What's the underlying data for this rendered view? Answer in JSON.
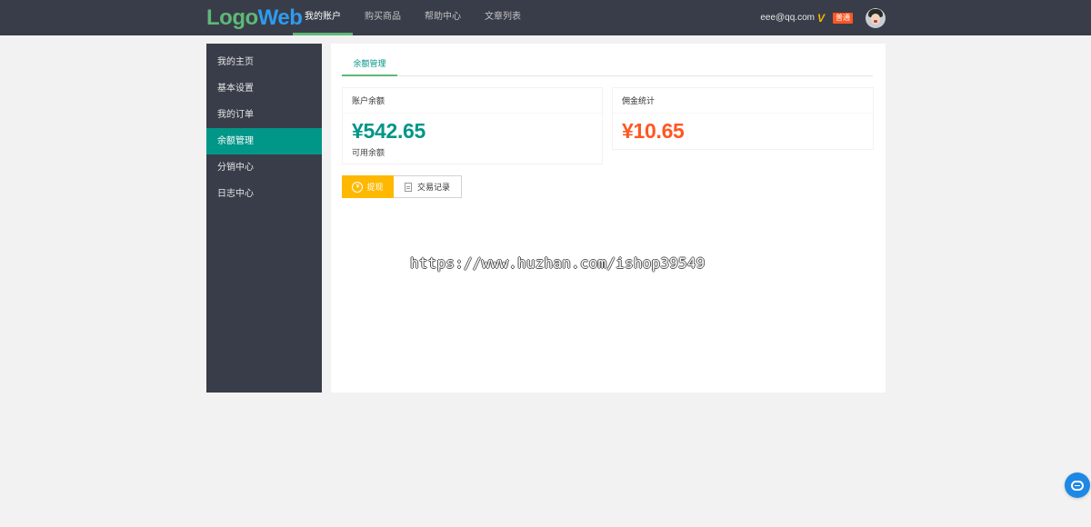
{
  "header": {
    "logo": {
      "part1": "Logo",
      "part2": "Web"
    },
    "nav": [
      {
        "label": "我的账户",
        "active": true
      },
      {
        "label": "购买商品",
        "active": false
      },
      {
        "label": "帮助中心",
        "active": false
      },
      {
        "label": "文章列表",
        "active": false
      }
    ],
    "user": {
      "email": "eee@qq.com",
      "vip_mark": "V",
      "badge": "普通"
    }
  },
  "sidebar": {
    "items": [
      {
        "label": "我的主页",
        "active": false
      },
      {
        "label": "基本设置",
        "active": false
      },
      {
        "label": "我的订单",
        "active": false
      },
      {
        "label": "余额管理",
        "active": true
      },
      {
        "label": "分销中心",
        "active": false
      },
      {
        "label": "日志中心",
        "active": false
      }
    ]
  },
  "main": {
    "tab": "余额管理",
    "balance_card": {
      "title": "账户余额",
      "amount": "¥542.65",
      "note": "可用余额"
    },
    "commission_card": {
      "title": "佣金统计",
      "amount": "¥10.65"
    },
    "buttons": {
      "withdraw_icon": "¥",
      "withdraw": "提现",
      "records": "交易记录"
    }
  },
  "watermark": "https://www.huzhan.com/ishop39549",
  "colors": {
    "topbar": "#393d49",
    "accent": "#009688",
    "orange": "#ff5722",
    "yellow": "#ffb800",
    "float": "#1e88e5"
  },
  "icons": {
    "float_button": "chat-bubble-icon",
    "records": "document-icon",
    "withdraw": "yen-circle-icon",
    "avatar": "user-avatar"
  }
}
